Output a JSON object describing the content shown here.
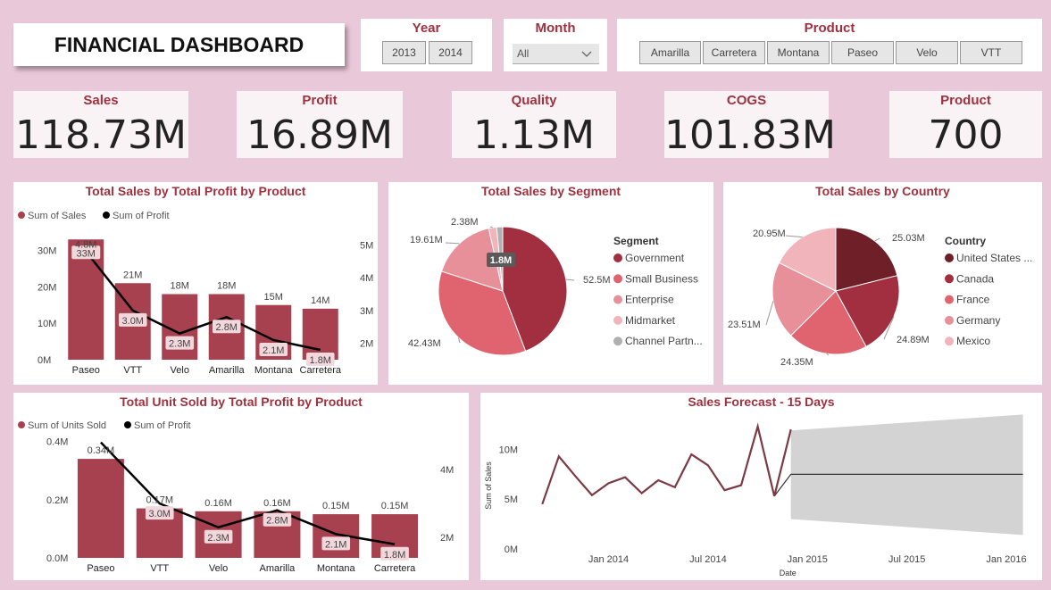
{
  "header": {
    "title": "FINANCIAL DASHBOARD"
  },
  "filters": {
    "year": {
      "title": "Year",
      "options": [
        "2013",
        "2014"
      ]
    },
    "month": {
      "title": "Month",
      "selected": "All"
    },
    "product": {
      "title": "Product",
      "options": [
        "Amarilla",
        "Carretera",
        "Montana",
        "Paseo",
        "Velo",
        "VTT"
      ]
    }
  },
  "kpis": [
    {
      "label": "Sales",
      "value": "118.73M"
    },
    {
      "label": "Profit",
      "value": "16.89M"
    },
    {
      "label": "Quality",
      "value": "1.13M"
    },
    {
      "label": "COGS",
      "value": "101.83M"
    },
    {
      "label": "Product",
      "value": "700"
    }
  ],
  "colors": {
    "bar": "#A8414F",
    "line": "#000000",
    "accent": "#A1303E",
    "seg": [
      "#A12F3F",
      "#E0646F",
      "#E79099",
      "#F0B4BA",
      "#B0B0B0"
    ],
    "country": [
      "#6E1F27",
      "#A12F3F",
      "#E0646F",
      "#E79099",
      "#F0B4BA"
    ],
    "forecast_band": "#D3D3D3",
    "forecast_line": "#7B3A44"
  },
  "chart_data": [
    {
      "type": "bar",
      "title": "Total Sales by Total Profit by Product",
      "legend": [
        "Sum of  Sales",
        "Sum of Profit"
      ],
      "categories": [
        "Paseo",
        "VTT",
        "Velo",
        "Amarilla",
        "Montana",
        "Carretera"
      ],
      "series": [
        {
          "name": "Sum of  Sales",
          "values": [
            33,
            21,
            18,
            18,
            15,
            14
          ],
          "labels": [
            "33M",
            "21M",
            "18M",
            "18M",
            "15M",
            "14M"
          ]
        },
        {
          "name": "Sum of Profit",
          "values": [
            4.8,
            3.0,
            2.3,
            2.8,
            2.1,
            1.8
          ],
          "labels": [
            "4.8M",
            "3.0M",
            "2.3M",
            "2.8M",
            "2.1M",
            "1.8M"
          ]
        }
      ],
      "y_ticks": [
        "0M",
        "10M",
        "20M",
        "30M"
      ],
      "y2_ticks": [
        "2M",
        "3M",
        "4M",
        "5M"
      ],
      "ylim": [
        0,
        36
      ],
      "y2lim": [
        1.5,
        5.5
      ]
    },
    {
      "type": "pie",
      "title": "Total Sales by Segment",
      "legend_title": "Segment",
      "labels": [
        "Government",
        "Small Business",
        "Enterprise",
        "Midmarket",
        "Channel Partn..."
      ],
      "values": [
        52.5,
        42.43,
        19.61,
        2.38,
        1.8
      ],
      "data_labels": [
        "52.5M",
        "42.43M",
        "19.61M",
        "2.38M",
        "1.8M"
      ]
    },
    {
      "type": "pie",
      "title": "Total Sales by Country",
      "legend_title": "Country",
      "labels": [
        "United States ...",
        "Canada",
        "France",
        "Germany",
        "Mexico"
      ],
      "values": [
        25.03,
        24.89,
        24.35,
        23.51,
        20.95
      ],
      "data_labels": [
        "25.03M",
        "24.89M",
        "24.35M",
        "23.51M",
        "20.95M"
      ]
    },
    {
      "type": "bar",
      "title": "Total Unit Sold by Total Profit by Product",
      "legend": [
        "Sum of Units Sold",
        "Sum of Profit"
      ],
      "categories": [
        "Paseo",
        "VTT",
        "Velo",
        "Amarilla",
        "Montana",
        "Carretera"
      ],
      "series": [
        {
          "name": "Sum of Units Sold",
          "values": [
            0.34,
            0.17,
            0.16,
            0.16,
            0.15,
            0.15
          ],
          "labels": [
            "0.34M",
            "0.17M",
            "0.16M",
            "0.16M",
            "0.15M",
            "0.15M"
          ]
        },
        {
          "name": "Sum of Profit",
          "values": [
            4.8,
            3.0,
            2.3,
            2.8,
            2.1,
            1.8
          ],
          "labels": [
            "",
            "3.0M",
            "2.3M",
            "2.8M",
            "2.1M",
            "1.8M"
          ]
        }
      ],
      "y_ticks": [
        "0.0M",
        "0.2M",
        "0.4M"
      ],
      "y2_ticks": [
        "2M",
        "4M"
      ],
      "ylim": [
        0,
        0.42
      ],
      "y2lim": [
        1.4,
        5.0
      ]
    },
    {
      "type": "line",
      "title": "Sales Forecast - 15 Days",
      "xlabel": "Date",
      "ylabel": "Sum of Sales",
      "x_ticks": [
        "Jan 2014",
        "Jul 2014",
        "Jan 2015",
        "Jul 2015",
        "Jan 2016"
      ],
      "y_ticks": [
        "0M",
        "5M",
        "10M"
      ],
      "ylim": [
        0,
        13
      ],
      "actual": [
        {
          "x": "2013-09",
          "y": 4.5
        },
        {
          "x": "2013-10",
          "y": 9.3
        },
        {
          "x": "2013-11",
          "y": 7.3
        },
        {
          "x": "2013-12",
          "y": 5.4
        },
        {
          "x": "2014-01",
          "y": 6.6
        },
        {
          "x": "2014-02",
          "y": 7.2
        },
        {
          "x": "2014-03",
          "y": 5.6
        },
        {
          "x": "2014-04",
          "y": 6.9
        },
        {
          "x": "2014-05",
          "y": 6.2
        },
        {
          "x": "2014-06",
          "y": 9.5
        },
        {
          "x": "2014-07",
          "y": 8.4
        },
        {
          "x": "2014-08",
          "y": 5.9
        },
        {
          "x": "2014-09",
          "y": 6.4
        },
        {
          "x": "2014-10",
          "y": 12.3
        },
        {
          "x": "2014-11",
          "y": 5.3
        },
        {
          "x": "2014-12",
          "y": 12.0
        }
      ],
      "forecast": {
        "value": 7.5,
        "upper_start": 11.9,
        "upper_end": 13.5,
        "lower_start": 3.0,
        "lower_end": 1.4,
        "start": "2014-12",
        "end": "2016-02"
      }
    }
  ]
}
